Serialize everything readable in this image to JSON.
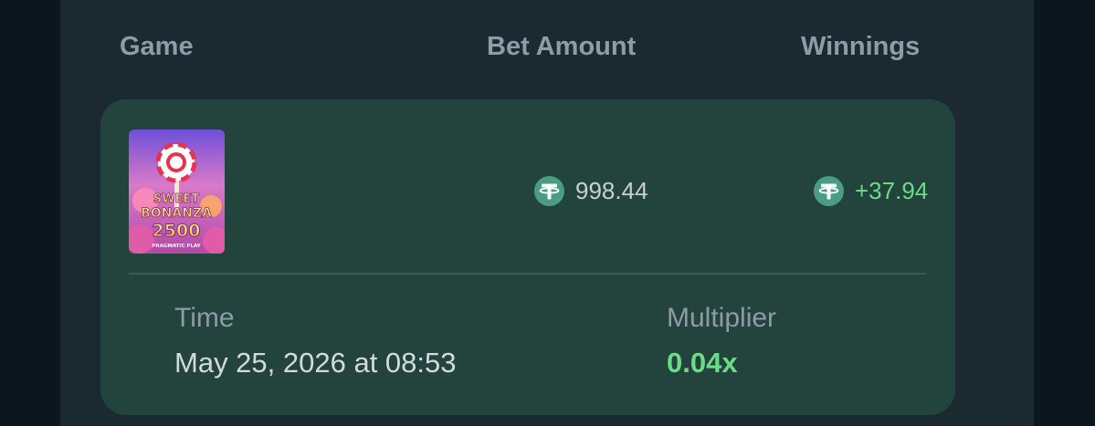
{
  "header": {
    "game_label": "Game",
    "bet_label": "Bet Amount",
    "winnings_label": "Winnings"
  },
  "bet": {
    "game": {
      "name": "Sweet Bonanza 2500",
      "thumbnail_line1": "SWEET",
      "thumbnail_line2": "BONANZA",
      "thumbnail_line3": "2500",
      "provider": "PRAGMATIC PLAY"
    },
    "currency_icon": "tether-usdt-icon",
    "bet_amount": "998.44",
    "winnings": "+37.94",
    "time_label": "Time",
    "time_value": "May 25, 2026 at 08:53",
    "multiplier_label": "Multiplier",
    "multiplier_value": "0.04x"
  },
  "colors": {
    "page_background": "#0b161d",
    "panel_background": "#1b2931",
    "card_background": "#23443c",
    "muted_text": "#8e9ba8",
    "positive": "#6bdc86",
    "coin": "#4a9d82"
  }
}
